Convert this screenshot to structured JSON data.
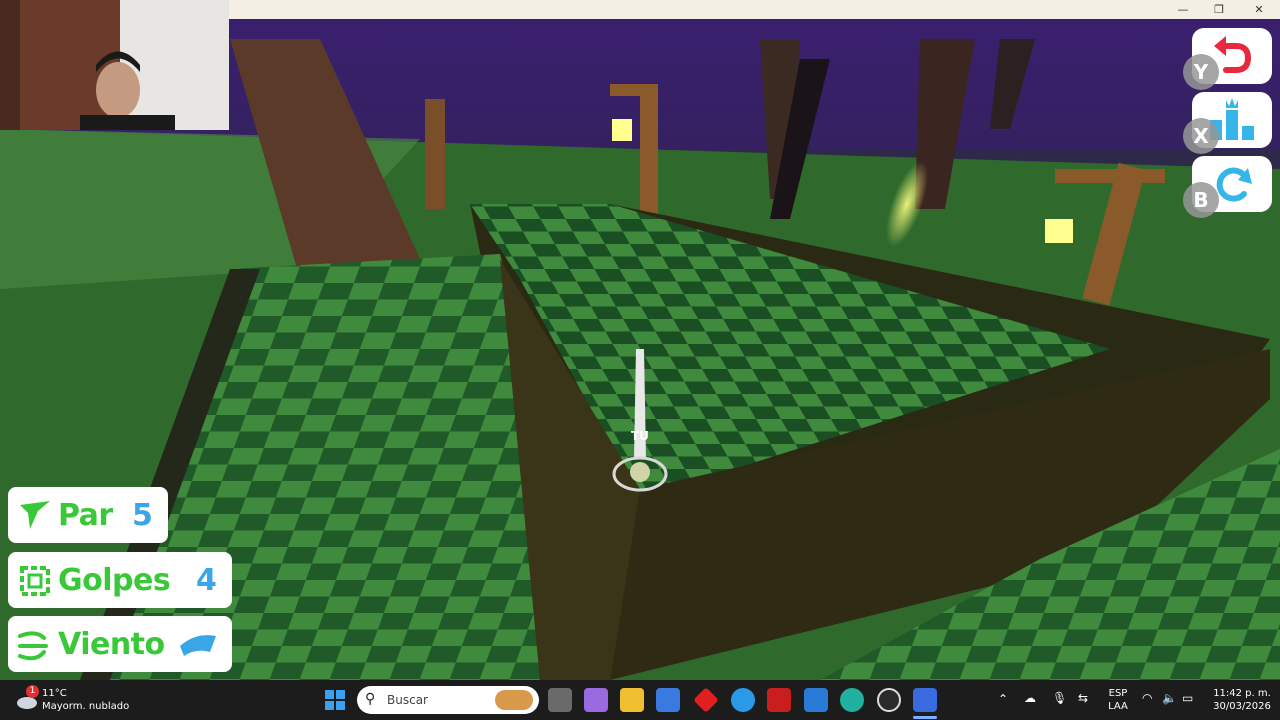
{
  "window": {
    "minimize_icon": "minimize-icon",
    "maximize_icon": "restore-icon",
    "close_icon": "close-icon",
    "minimize_glyph": "—",
    "maximize_glyph": "❐",
    "close_glyph": "✕"
  },
  "game": {
    "ball_tag": "TU",
    "buttons": [
      {
        "key": "Y",
        "icon": "undo-icon"
      },
      {
        "key": "X",
        "icon": "leaderboard-icon"
      },
      {
        "key": "B",
        "icon": "reset-icon"
      }
    ],
    "hud": {
      "par_label": "Par",
      "par_value": "5",
      "strokes_label": "Golpes",
      "strokes_value": "4",
      "wind_label": "Viento"
    },
    "colors": {
      "hud_label": "#38c838",
      "hud_value": "#3aa6e8",
      "undo_red": "#e8283c",
      "leaderboard_blue": "#36b6e8"
    }
  },
  "taskbar": {
    "weather_badge": "1",
    "weather_temp": "11°C",
    "weather_desc": "Mayorm. nublado",
    "search_placeholder": "Buscar",
    "language_line1": "ESP",
    "language_line2": "LAA",
    "time": "11:42 p. m.",
    "date": "30/03/2026",
    "apps": [
      "windows-start-icon",
      "task-view-icon",
      "copilot-icon",
      "file-explorer-icon",
      "store-icon",
      "app-red-icon",
      "browser-icon",
      "mcafee-icon",
      "mail-icon",
      "edge-icon",
      "chatgpt-icon",
      "roblox-icon"
    ]
  }
}
